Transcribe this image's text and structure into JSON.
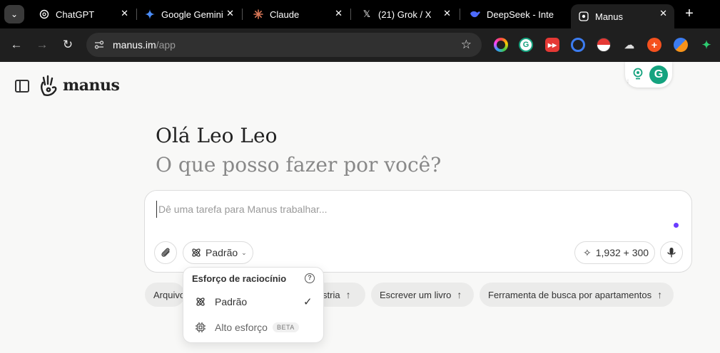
{
  "browser": {
    "tabs": [
      {
        "label": "ChatGPT",
        "icon": "chatgpt-icon"
      },
      {
        "label": "Google Gemini",
        "icon": "gemini-icon"
      },
      {
        "label": "Claude",
        "icon": "claude-icon"
      },
      {
        "label": "(21) Grok / X",
        "icon": "x-icon"
      },
      {
        "label": "DeepSeek - Inte",
        "icon": "deepseek-icon"
      },
      {
        "label": "Manus",
        "icon": "manus-icon",
        "active": true
      }
    ],
    "new_tab_label": "+",
    "address": {
      "host": "manus.im",
      "path": "/app"
    }
  },
  "app": {
    "logo_text": "manus",
    "greeting": "Olá Leo Leo",
    "subgreeting": "O que posso fazer por você?",
    "composer": {
      "placeholder": "Dê uma tarefa para Manus trabalhar...",
      "value": "",
      "mode_label": "Padrão",
      "credits": "1,932 + 300"
    },
    "chips": [
      {
        "label": "Arquivo"
      },
      {
        "label": "stria"
      },
      {
        "label": "Escrever um livro"
      },
      {
        "label": "Ferramenta de busca por apartamentos"
      }
    ],
    "reasoning_menu": {
      "title": "Esforço de raciocínio",
      "items": [
        {
          "label": "Padrão",
          "selected": true
        },
        {
          "label": "Alto esforço",
          "badge": "BETA"
        }
      ]
    }
  },
  "colors": {
    "accent_dot": "#6a3cff",
    "grammarly_green": "#15a37f",
    "page_bg": "#f8f8f7"
  }
}
